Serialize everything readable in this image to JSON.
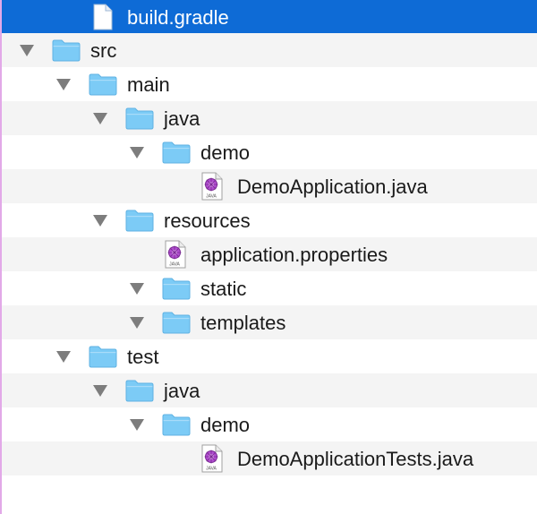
{
  "tree": {
    "items": [
      {
        "label": "build.gradle",
        "icon": "document-icon",
        "depth": 1,
        "expanded": false,
        "selected": true
      },
      {
        "label": "src",
        "icon": "folder-icon",
        "depth": 0,
        "expanded": true,
        "selected": false
      },
      {
        "label": "main",
        "icon": "folder-icon",
        "depth": 1,
        "expanded": true,
        "selected": false
      },
      {
        "label": "java",
        "icon": "folder-icon",
        "depth": 2,
        "expanded": true,
        "selected": false
      },
      {
        "label": "demo",
        "icon": "folder-icon",
        "depth": 3,
        "expanded": true,
        "selected": false
      },
      {
        "label": "DemoApplication.java",
        "icon": "java-file-icon",
        "depth": 4,
        "expanded": false,
        "selected": false
      },
      {
        "label": "resources",
        "icon": "folder-icon",
        "depth": 2,
        "expanded": true,
        "selected": false
      },
      {
        "label": "application.properties",
        "icon": "java-file-icon",
        "depth": 3,
        "expanded": false,
        "selected": false
      },
      {
        "label": "static",
        "icon": "folder-icon",
        "depth": 3,
        "expanded": true,
        "selected": false
      },
      {
        "label": "templates",
        "icon": "folder-icon",
        "depth": 3,
        "expanded": true,
        "selected": false
      },
      {
        "label": "test",
        "icon": "folder-icon",
        "depth": 1,
        "expanded": true,
        "selected": false
      },
      {
        "label": "java",
        "icon": "folder-icon",
        "depth": 2,
        "expanded": true,
        "selected": false
      },
      {
        "label": "demo",
        "icon": "folder-icon",
        "depth": 3,
        "expanded": true,
        "selected": false
      },
      {
        "label": "DemoApplicationTests.java",
        "icon": "java-file-icon",
        "depth": 4,
        "expanded": false,
        "selected": false
      }
    ]
  },
  "colors": {
    "selection": "#0e6bd6",
    "alt_row": "#f4f4f4",
    "folder": "#7ccbf6",
    "disclosure": "#7d7d7d"
  }
}
